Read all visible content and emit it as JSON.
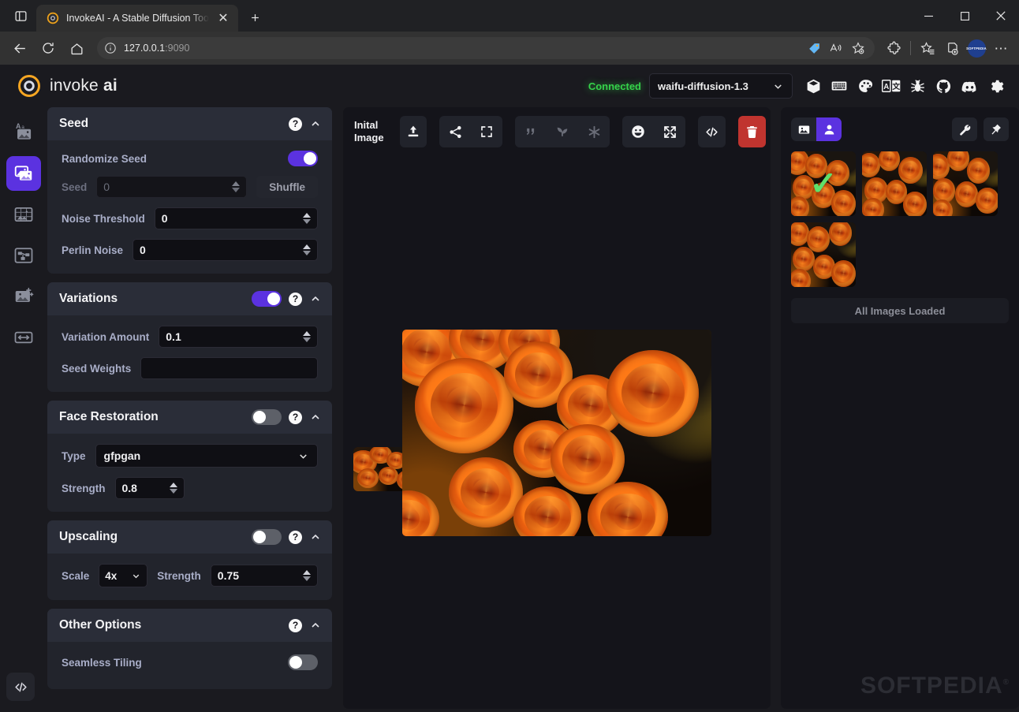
{
  "browser": {
    "tab_title": "InvokeAI - A Stable Diffusion Too",
    "url_host": "127.0.0.1",
    "url_port": ":9090",
    "new_tab_label": "+",
    "close_label": "✕",
    "minimize_label": "─",
    "maximize_label": "☐",
    "window_close_label": "✕",
    "profile_label": "SOFTPEDIA",
    "more_label": "⋯"
  },
  "app_header": {
    "logo_text_light": "invoke",
    "logo_text_bold": "ai",
    "status": "Connected",
    "model": "waifu-diffusion-1.3",
    "icons": [
      {
        "name": "model-manager-icon",
        "glyph": "cube"
      },
      {
        "name": "hotkeys-icon",
        "glyph": "keyboard"
      },
      {
        "name": "theme-icon",
        "glyph": "palette"
      },
      {
        "name": "language-icon",
        "glyph": "translate"
      },
      {
        "name": "bug-report-icon",
        "glyph": "bug"
      },
      {
        "name": "github-icon",
        "glyph": "github"
      },
      {
        "name": "discord-icon",
        "glyph": "discord"
      },
      {
        "name": "settings-icon",
        "glyph": "gear"
      }
    ]
  },
  "rail": {
    "items": [
      {
        "name": "sidebar-item-text-to-image",
        "icon": "text-to-image-icon",
        "active": false
      },
      {
        "name": "sidebar-item-image-to-image",
        "icon": "image-to-image-icon",
        "active": true
      },
      {
        "name": "sidebar-item-unified-canvas",
        "icon": "unified-canvas-icon",
        "active": false
      },
      {
        "name": "sidebar-item-nodes",
        "icon": "nodes-icon",
        "active": false
      },
      {
        "name": "sidebar-item-post-processing",
        "icon": "post-processing-icon",
        "active": false
      },
      {
        "name": "sidebar-item-training",
        "icon": "training-icon",
        "active": false
      }
    ],
    "bottom_icon": "console-code-icon"
  },
  "options": {
    "seed": {
      "title": "Seed",
      "randomize_label": "Randomize Seed",
      "randomize_on": true,
      "seed_label": "Seed",
      "seed_value": "0",
      "shuffle_label": "Shuffle",
      "noise_threshold_label": "Noise Threshold",
      "noise_threshold_value": "0",
      "perlin_noise_label": "Perlin Noise",
      "perlin_noise_value": "0"
    },
    "variations": {
      "title": "Variations",
      "enabled": true,
      "amount_label": "Variation Amount",
      "amount_value": "0.1",
      "seed_weights_label": "Seed Weights",
      "seed_weights_value": ""
    },
    "face_restoration": {
      "title": "Face Restoration",
      "enabled": false,
      "type_label": "Type",
      "type_value": "gfpgan",
      "strength_label": "Strength",
      "strength_value": "0.8"
    },
    "upscaling": {
      "title": "Upscaling",
      "enabled": false,
      "scale_label": "Scale",
      "scale_value": "4x",
      "strength_label": "Strength",
      "strength_value": "0.75"
    },
    "other": {
      "title": "Other Options",
      "seamless_label": "Seamless Tiling",
      "seamless_on": false
    }
  },
  "canvas": {
    "init_image_label_line1": "Inital",
    "init_image_label_line2": "Image",
    "toolbar": [
      {
        "name": "upload-image-button",
        "glyph": "upload",
        "dim": false,
        "danger": false
      },
      {
        "name": "share-image-button",
        "glyph": "share",
        "dim": false,
        "danger": false
      },
      {
        "name": "fullscreen-button",
        "glyph": "expand-corners",
        "dim": false,
        "danger": false
      },
      {
        "name": "use-prompt-button",
        "glyph": "quote",
        "dim": true,
        "danger": false
      },
      {
        "name": "use-seed-button",
        "glyph": "seedling",
        "dim": true,
        "danger": false
      },
      {
        "name": "use-all-parameters-button",
        "glyph": "asterisk",
        "dim": true,
        "danger": false
      },
      {
        "name": "restore-faces-button",
        "glyph": "smiley",
        "dim": false,
        "danger": false
      },
      {
        "name": "upscale-button",
        "glyph": "arrows-out",
        "dim": false,
        "danger": false
      },
      {
        "name": "show-metadata-button",
        "glyph": "code",
        "dim": false,
        "danger": false
      },
      {
        "name": "delete-image-button",
        "glyph": "trash",
        "dim": false,
        "danger": true
      }
    ]
  },
  "gallery": {
    "tab_images_icon": "image-icon",
    "tab_person_icon": "person-icon",
    "settings_icon": "wrench-icon",
    "pin_icon": "pin-icon",
    "thumbnails": [
      {
        "name": "gallery-thumbnail",
        "selected": true
      },
      {
        "name": "gallery-thumbnail",
        "selected": false
      },
      {
        "name": "gallery-thumbnail",
        "selected": false
      },
      {
        "name": "gallery-thumbnail",
        "selected": false
      }
    ],
    "status": "All Images Loaded",
    "watermark": "SOFTPEDIA"
  },
  "colors": {
    "accent_purple": "#5b32e0",
    "status_green": "#35d24a",
    "danger_red": "#c0342f",
    "panel_bg": "#22242c",
    "panel_head_bg": "#2a2d38",
    "app_bg": "#1a1a1f"
  }
}
